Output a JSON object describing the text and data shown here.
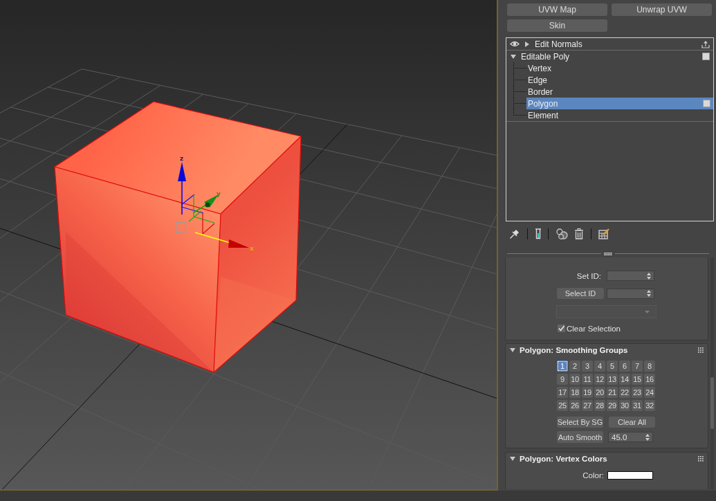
{
  "viewport": {
    "gizmo": {
      "z_label": "z",
      "y_label": "y",
      "x_label": "x"
    }
  },
  "modifier_buttons": [
    {
      "label": "UVW Map"
    },
    {
      "label": "Unwrap UVW"
    },
    {
      "label": "Skin"
    }
  ],
  "modifier_stack": [
    {
      "kind": "modifier",
      "label": "Edit Normals",
      "enabled": true,
      "expanded": false,
      "selected": false
    },
    {
      "kind": "base_object",
      "label": "Editable Poly",
      "expanded": true,
      "selected": false,
      "children": [
        {
          "label": "Vertex",
          "selected": false
        },
        {
          "label": "Edge",
          "selected": false
        },
        {
          "label": "Border",
          "selected": false
        },
        {
          "label": "Polygon",
          "selected": true
        },
        {
          "label": "Element",
          "selected": false
        }
      ]
    }
  ],
  "material_ids": {
    "set_id_label": "Set ID:",
    "select_id_button": "Select ID",
    "name_dropdown": {
      "disabled": true
    },
    "clear_selection": {
      "label": "Clear Selection",
      "checked": true
    }
  },
  "smoothing_groups": {
    "title": "Polygon: Smoothing Groups",
    "expanded": true,
    "groups": [
      {
        "label": "1",
        "selected": true
      },
      {
        "label": "2",
        "selected": false
      },
      {
        "label": "3",
        "selected": false
      },
      {
        "label": "4",
        "selected": false
      },
      {
        "label": "5",
        "selected": false
      },
      {
        "label": "6",
        "selected": false
      },
      {
        "label": "7",
        "selected": false
      },
      {
        "label": "8",
        "selected": false
      },
      {
        "label": "9",
        "selected": false
      },
      {
        "label": "10",
        "selected": false
      },
      {
        "label": "11",
        "selected": false
      },
      {
        "label": "12",
        "selected": false
      },
      {
        "label": "13",
        "selected": false
      },
      {
        "label": "14",
        "selected": false
      },
      {
        "label": "15",
        "selected": false
      },
      {
        "label": "16",
        "selected": false
      },
      {
        "label": "17",
        "selected": false
      },
      {
        "label": "18",
        "selected": false
      },
      {
        "label": "19",
        "selected": false
      },
      {
        "label": "20",
        "selected": false
      },
      {
        "label": "21",
        "selected": false
      },
      {
        "label": "22",
        "selected": false
      },
      {
        "label": "23",
        "selected": false
      },
      {
        "label": "24",
        "selected": false
      },
      {
        "label": "25",
        "selected": false
      },
      {
        "label": "26",
        "selected": false
      },
      {
        "label": "27",
        "selected": false
      },
      {
        "label": "28",
        "selected": false
      },
      {
        "label": "29",
        "selected": false
      },
      {
        "label": "30",
        "selected": false
      },
      {
        "label": "31",
        "selected": false
      },
      {
        "label": "32",
        "selected": false
      }
    ],
    "select_by_sg_button": "Select By SG",
    "clear_all_button": "Clear All",
    "auto_smooth_button": "Auto Smooth",
    "threshold": "45.0"
  },
  "vertex_colors": {
    "title": "Polygon: Vertex Colors",
    "expanded": true,
    "color_label": "Color:"
  }
}
